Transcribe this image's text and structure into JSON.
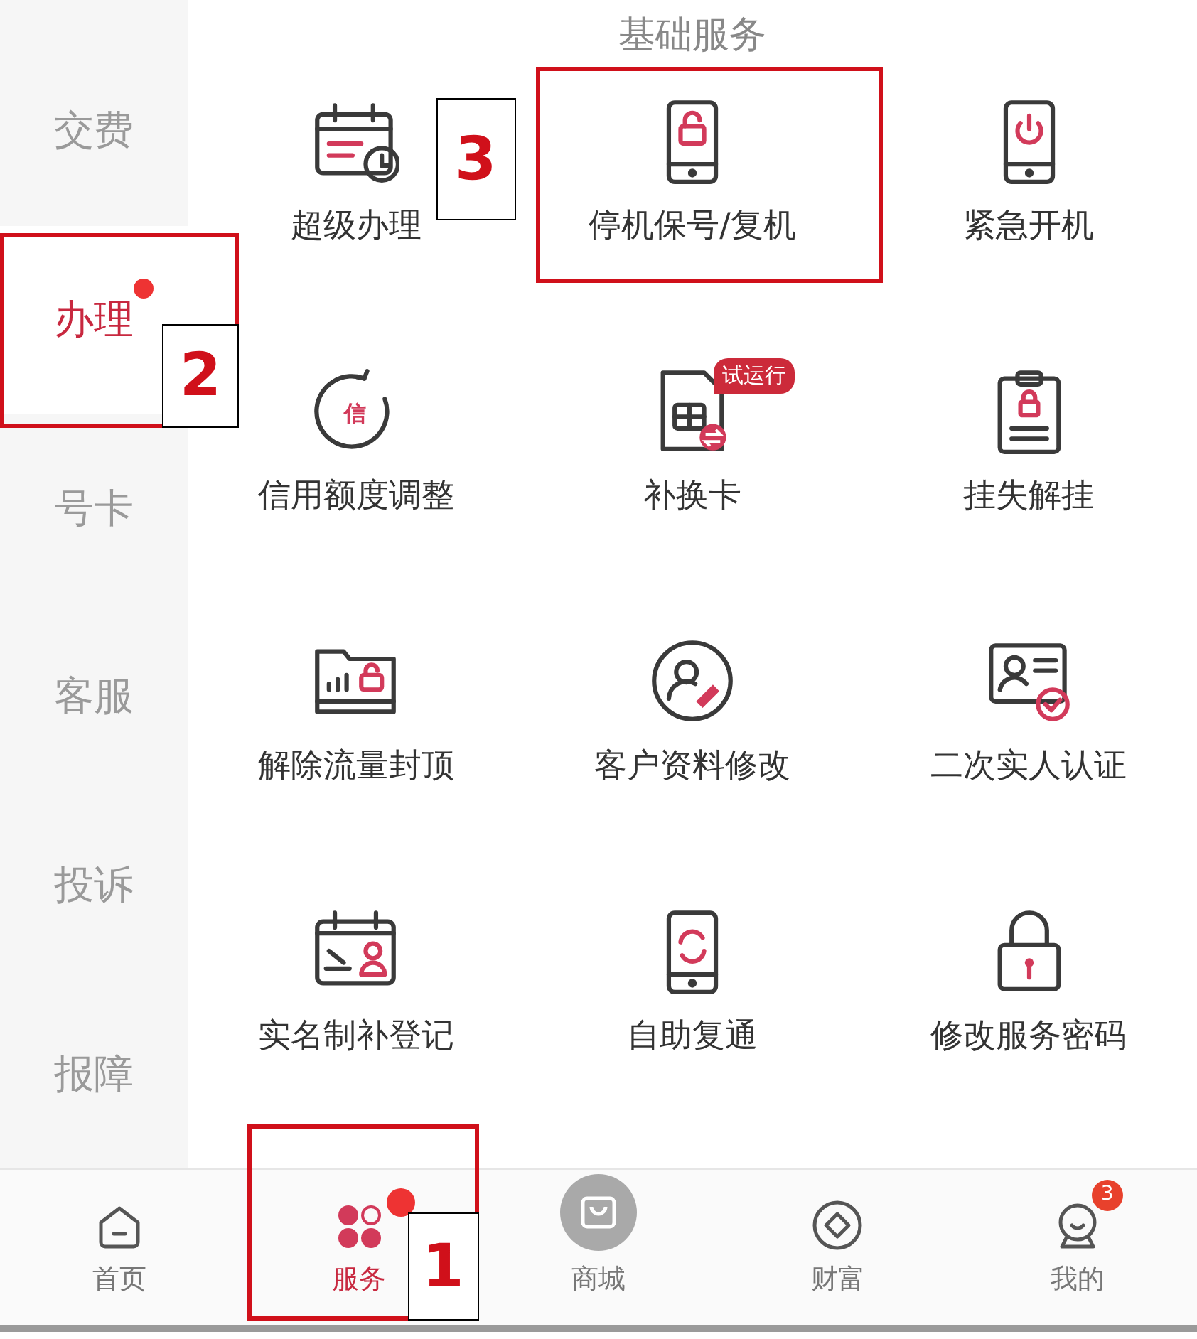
{
  "sidebar": {
    "items": [
      {
        "label": "交费",
        "selected": false,
        "dot": false
      },
      {
        "label": "办理",
        "selected": true,
        "dot": true,
        "annotation": "2"
      },
      {
        "label": "号卡",
        "selected": false,
        "dot": false
      },
      {
        "label": "客服",
        "selected": false,
        "dot": false
      },
      {
        "label": "投诉",
        "selected": false,
        "dot": false
      },
      {
        "label": "报障",
        "selected": false,
        "dot": false
      }
    ]
  },
  "section": {
    "title": "基础服务",
    "items": [
      {
        "label": "超级办理",
        "kind": "calendar-clock"
      },
      {
        "label": "停机保号/复机",
        "kind": "phone-lock",
        "annotation": "3"
      },
      {
        "label": "紧急开机",
        "kind": "phone-power"
      },
      {
        "label": "信用额度调整",
        "kind": "credit-circle",
        "icon_text": "信"
      },
      {
        "label": "补换卡",
        "kind": "sim-card",
        "badge": "试运行"
      },
      {
        "label": "挂失解挂",
        "kind": "clipboard-lock"
      },
      {
        "label": "解除流量封顶",
        "kind": "folder-lock"
      },
      {
        "label": "客户资料修改",
        "kind": "user-edit"
      },
      {
        "label": "二次实人认证",
        "kind": "id-check"
      },
      {
        "label": "实名制补登记",
        "kind": "calendar-user"
      },
      {
        "label": "自助复通",
        "kind": "phone-refresh"
      },
      {
        "label": "修改服务密码",
        "kind": "padlock"
      }
    ]
  },
  "bottom_nav": [
    {
      "label": "首页",
      "kind": "home",
      "selected": false
    },
    {
      "label": "服务",
      "kind": "clover",
      "selected": true,
      "dot": true,
      "annotation": "1"
    },
    {
      "label": "商城",
      "kind": "bag",
      "selected": false
    },
    {
      "label": "财富",
      "kind": "coin",
      "selected": false
    },
    {
      "label": "我的",
      "kind": "face",
      "selected": false,
      "badge": "3"
    }
  ]
}
